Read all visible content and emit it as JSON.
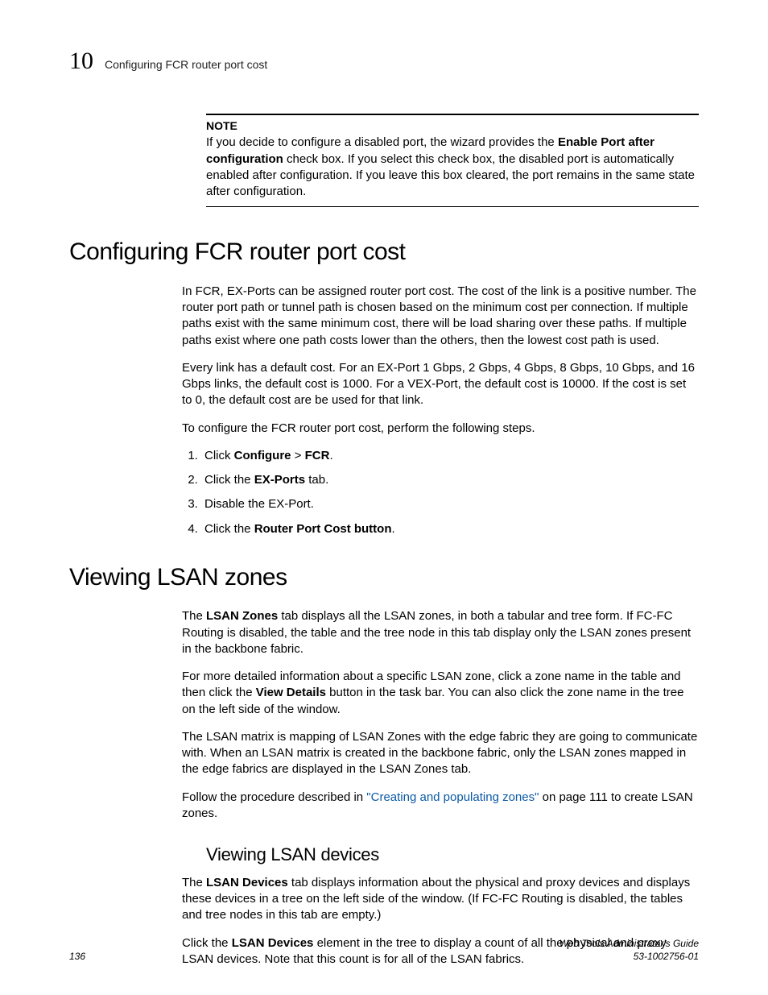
{
  "header": {
    "chapter_number": "10",
    "running_title": "Configuring FCR router port cost"
  },
  "note": {
    "label": "NOTE",
    "text_pre": "If you decide to configure a disabled port, the wizard provides the ",
    "bold1": "Enable Port after configuration",
    "text_post": " check box. If you select this check box, the disabled port is automatically enabled after configuration. If you leave this box cleared, the port remains in the same state after configuration."
  },
  "section1": {
    "title": "Configuring FCR router port cost",
    "p1": "In FCR, EX-Ports can be assigned router port cost. The cost of the link is a positive number. The router port path or tunnel path is chosen based on the minimum cost per connection. If multiple paths exist with the same minimum cost, there will be load sharing over these paths. If multiple paths exist where one path costs lower than the others, then the lowest cost path is used.",
    "p2": "Every link has a default cost. For an EX-Port 1 Gbps, 2 Gbps, 4 Gbps, 8 Gbps, 10 Gbps, and 16 Gbps links, the default cost is 1000. For a VEX-Port, the default cost is 10000. If the cost is set to 0, the default cost are be used for that link.",
    "p3": "To configure the FCR router port cost, perform the following steps.",
    "steps": {
      "s1_pre": "Click ",
      "s1_b1": "Configure",
      "s1_mid": " > ",
      "s1_b2": "FCR",
      "s1_post": ".",
      "s2_pre": "Click the ",
      "s2_b": "EX-Ports",
      "s2_post": " tab.",
      "s3": "Disable the EX-Port.",
      "s4_pre": "Click the ",
      "s4_b": "Router Port Cost button",
      "s4_post": "."
    }
  },
  "section2": {
    "title": "Viewing LSAN zones",
    "p1_pre": "The ",
    "p1_b": "LSAN Zones",
    "p1_post": " tab displays all the LSAN zones, in both a tabular and tree form. If FC-FC Routing is disabled, the table and the tree node in this tab display only the LSAN zones present in the backbone fabric.",
    "p2_pre": "For more detailed information about a specific LSAN zone, click a zone name in the table and then click the ",
    "p2_b": "View Details",
    "p2_post": " button in the task bar. You can also click the zone name in the tree on the left side of the window.",
    "p3": "The LSAN matrix is mapping of LSAN Zones with the edge fabric they are going to communicate with. When an LSAN matrix is created in the backbone fabric, only the LSAN zones mapped in the edge fabrics are displayed in the LSAN Zones tab.",
    "p4_pre": "Follow the procedure described in ",
    "p4_link": "\"Creating and populating zones\"",
    "p4_post": " on page 111 to create LSAN zones."
  },
  "subsection": {
    "title": "Viewing LSAN devices",
    "p1_pre": "The ",
    "p1_b": "LSAN Devices",
    "p1_post": " tab displays information about the physical and proxy devices and displays these devices in a tree on the left side of the window. (If FC-FC Routing is disabled, the tables and tree nodes in this tab are empty.)",
    "p2_pre": "Click the ",
    "p2_b": "LSAN Devices",
    "p2_post": " element in the tree to display a count of all the physical and proxy LSAN devices. Note that this count is for all of the LSAN fabrics."
  },
  "footer": {
    "page": "136",
    "book": "Web Tools Administrator's Guide",
    "docnum": "53-1002756-01"
  }
}
